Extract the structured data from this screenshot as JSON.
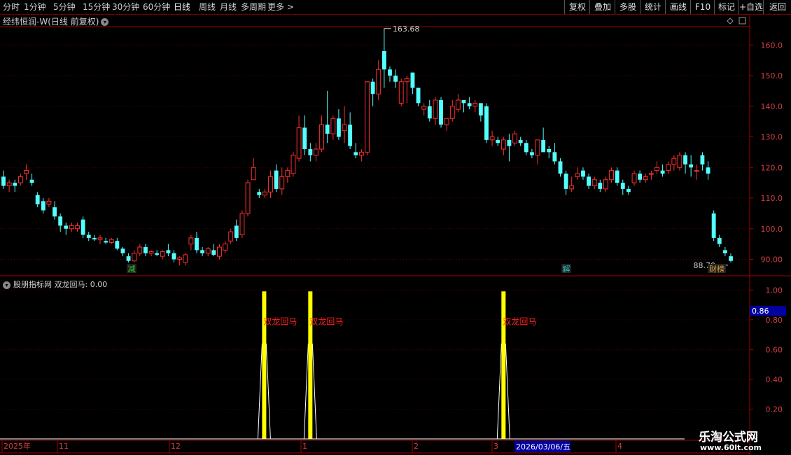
{
  "toolbar": {
    "periods": [
      "分时",
      "1分钟",
      "5分钟",
      "15分钟",
      "30分钟",
      "60分钟",
      "日线",
      "周线",
      "月线",
      "多周期",
      "更多 >"
    ],
    "active_period": "日线",
    "right_buttons": [
      "复权",
      "叠加",
      "多股",
      "统计",
      "画线",
      "F10",
      "标记",
      "+自选",
      "返回"
    ]
  },
  "main_chart": {
    "title": "经纬恒润-W(日线 前复权)",
    "high_label": "163.68",
    "low_label": "88.70",
    "y_ticks": [
      "160.0",
      "150.0",
      "140.0",
      "130.0",
      "120.0",
      "110.0",
      "100.0",
      "90.00"
    ],
    "markers": [
      {
        "text": "减",
        "color": "#30c030"
      },
      {
        "text": "解",
        "color": "#30c0c0"
      },
      {
        "text": "财榜",
        "color": "#e0a040"
      }
    ]
  },
  "indicator": {
    "title": "股朋指标网 双龙回马: 0.00",
    "signal_label": "双龙回马",
    "current_value": "0.86",
    "y_ticks": [
      "1.00",
      "0.80",
      "0.60",
      "0.40",
      "0.20"
    ]
  },
  "date_axis": {
    "labels": [
      "2025年",
      "11",
      "12",
      "1",
      "2",
      "3",
      "4"
    ],
    "cursor_date": "2026/03/06/五"
  },
  "watermark": {
    "line1": "乐淘公式网",
    "line2": "www.60lt.com"
  },
  "colors": {
    "up": "#ff3030",
    "down": "#54ffff",
    "signal_bar": "#ffff00",
    "axis": "#a00000"
  },
  "chart_data": {
    "type": "candlestick",
    "y_range": [
      86,
      166
    ],
    "candles": [
      [
        117,
        119,
        113,
        114
      ],
      [
        114,
        116,
        112,
        115
      ],
      [
        115,
        116,
        112,
        114
      ],
      [
        115,
        118,
        114,
        117
      ],
      [
        118,
        121,
        116,
        119
      ],
      [
        116,
        118,
        114,
        115
      ],
      [
        111,
        112,
        107,
        108
      ],
      [
        109,
        110,
        105,
        106
      ],
      [
        108,
        110,
        107,
        109
      ],
      [
        107,
        109,
        103,
        104
      ],
      [
        104,
        105,
        99,
        101
      ],
      [
        101,
        102,
        98,
        100
      ],
      [
        100,
        102,
        99,
        101
      ],
      [
        100,
        102,
        99,
        101
      ],
      [
        103,
        104,
        97,
        98
      ],
      [
        98,
        99,
        96,
        97
      ],
      [
        97,
        98,
        96,
        96.5
      ],
      [
        96.5,
        98,
        95,
        97
      ],
      [
        96,
        97,
        95,
        95.5
      ],
      [
        95.5,
        97,
        95,
        96.5
      ],
      [
        96,
        97,
        93,
        93.5
      ],
      [
        93.5,
        94,
        91,
        92
      ],
      [
        91,
        92,
        89,
        89.5
      ],
      [
        89.5,
        93,
        89,
        92
      ],
      [
        92,
        95,
        91,
        94
      ],
      [
        94,
        95,
        91,
        92
      ],
      [
        92,
        93,
        91,
        92.5
      ],
      [
        92,
        93,
        91,
        91.5
      ],
      [
        91,
        93,
        90,
        92.5
      ],
      [
        93,
        95,
        91,
        92
      ],
      [
        92,
        93,
        89,
        90
      ],
      [
        90,
        91,
        88,
        90.5
      ],
      [
        89,
        92,
        88,
        91.5
      ],
      [
        95,
        98,
        93,
        97
      ],
      [
        97,
        99,
        92,
        93
      ],
      [
        93,
        94,
        91,
        92
      ],
      [
        92,
        94,
        91,
        93.5
      ],
      [
        93,
        95,
        91,
        91.5
      ],
      [
        91,
        95,
        90,
        94
      ],
      [
        93,
        96,
        92,
        95
      ],
      [
        96,
        100,
        95,
        99
      ],
      [
        101,
        103,
        96,
        97
      ],
      [
        98,
        106,
        97,
        105
      ],
      [
        105,
        116,
        104,
        115
      ],
      [
        116,
        123,
        116,
        120
      ],
      [
        112,
        113,
        110,
        111
      ],
      [
        111,
        113,
        110,
        112
      ],
      [
        112,
        119,
        110,
        117
      ],
      [
        119,
        121,
        112,
        113
      ],
      [
        113,
        120,
        111,
        117
      ],
      [
        117,
        120,
        115,
        119
      ],
      [
        118,
        125,
        117,
        124
      ],
      [
        123,
        137,
        122,
        133
      ],
      [
        133,
        137,
        124,
        126
      ],
      [
        126,
        128,
        122,
        124
      ],
      [
        124,
        128,
        122,
        126
      ],
      [
        126,
        137,
        125,
        134
      ],
      [
        134,
        145,
        128,
        131
      ],
      [
        131,
        137,
        129,
        136
      ],
      [
        136,
        139,
        129,
        130
      ],
      [
        132,
        140,
        128,
        134
      ],
      [
        134,
        138,
        126,
        127
      ],
      [
        125,
        128,
        123,
        124
      ],
      [
        124,
        126,
        122,
        125
      ],
      [
        125,
        148,
        124,
        148
      ],
      [
        148,
        149,
        140,
        144
      ],
      [
        144,
        155,
        142,
        152
      ],
      [
        158,
        164,
        146,
        152
      ],
      [
        152,
        153,
        148,
        150
      ],
      [
        150,
        152,
        146,
        148
      ],
      [
        141,
        149,
        140,
        148
      ],
      [
        148,
        150,
        141,
        149
      ],
      [
        151,
        151,
        144,
        146
      ],
      [
        146,
        146,
        140,
        141
      ],
      [
        139,
        141,
        137,
        140
      ],
      [
        140,
        142,
        135,
        136
      ],
      [
        136,
        143,
        134,
        142
      ],
      [
        142,
        143,
        133,
        134
      ],
      [
        134,
        136,
        132,
        136
      ],
      [
        136,
        142,
        135,
        140
      ],
      [
        139,
        144,
        138,
        142
      ],
      [
        142,
        142,
        138,
        141
      ],
      [
        141,
        143,
        139,
        140
      ],
      [
        140,
        142,
        138,
        141
      ],
      [
        141,
        141,
        135,
        137
      ],
      [
        140,
        141,
        128,
        129
      ],
      [
        129,
        132,
        127,
        130
      ],
      [
        129,
        130,
        127,
        128
      ],
      [
        126,
        130,
        124,
        129
      ],
      [
        129,
        131,
        122,
        127
      ],
      [
        128,
        132,
        127,
        131
      ],
      [
        129,
        130,
        127,
        128
      ],
      [
        128,
        129,
        124,
        125
      ],
      [
        125,
        126,
        123,
        124
      ],
      [
        124,
        129,
        121,
        129
      ],
      [
        129,
        133,
        127,
        125
      ],
      [
        126,
        127,
        123,
        125
      ],
      [
        125,
        128,
        121,
        122
      ],
      [
        122,
        123,
        117,
        118
      ],
      [
        118,
        119,
        111,
        113
      ],
      [
        113,
        117,
        112,
        114
      ],
      [
        117,
        120,
        116,
        118
      ],
      [
        119,
        120,
        116,
        117
      ],
      [
        117,
        118,
        113,
        114
      ],
      [
        114,
        117,
        113,
        116
      ],
      [
        115,
        116,
        112,
        113
      ],
      [
        113,
        117,
        112,
        116
      ],
      [
        116,
        120,
        115,
        119
      ],
      [
        119,
        120,
        114,
        115
      ],
      [
        115,
        116,
        111,
        113
      ],
      [
        113,
        114,
        111,
        112
      ],
      [
        115,
        119,
        114,
        118
      ],
      [
        118,
        119,
        115,
        116
      ],
      [
        116,
        118,
        115,
        117
      ],
      [
        118,
        119,
        116,
        118
      ],
      [
        119,
        122,
        118,
        120
      ],
      [
        119,
        121,
        117,
        118
      ],
      [
        119,
        122,
        118,
        121
      ],
      [
        121,
        124,
        119,
        123
      ],
      [
        120,
        125,
        119,
        124
      ],
      [
        124,
        125,
        118,
        121
      ],
      [
        121,
        124,
        117,
        120
      ],
      [
        119,
        121,
        116,
        119
      ],
      [
        124,
        125,
        119,
        121
      ],
      [
        120,
        122,
        116,
        118
      ],
      [
        105,
        106,
        96,
        97
      ],
      [
        97,
        98,
        94,
        95
      ],
      [
        93,
        94,
        91,
        92
      ],
      [
        91,
        92,
        89,
        89.5
      ]
    ],
    "indicator_signals": [
      {
        "candle_index": 46,
        "value": 1.0
      },
      {
        "candle_index": 54,
        "value": 1.0
      },
      {
        "candle_index": 88,
        "value": 1.0
      }
    ],
    "indicator_range": [
      0,
      1.1
    ]
  }
}
